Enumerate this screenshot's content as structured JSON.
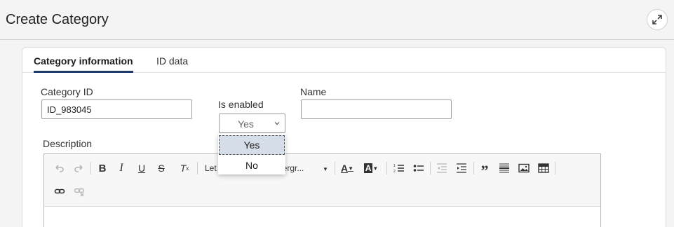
{
  "header": {
    "title": "Create Category",
    "expand_icon": "expand-icon"
  },
  "tabs": [
    {
      "label": "Category information",
      "active": true
    },
    {
      "label": "ID data",
      "active": false
    }
  ],
  "form": {
    "category_id": {
      "label": "Category ID",
      "value": "ID_983045"
    },
    "is_enabled": {
      "label": "Is enabled",
      "value": "Yes",
      "options": [
        "Yes",
        "No"
      ],
      "highlighted": "Yes"
    },
    "name": {
      "label": "Name",
      "value": ""
    },
    "description": {
      "label": "Description"
    }
  },
  "toolbar": {
    "font_combo": "Let",
    "format_combo": "ttergr...",
    "icons": [
      "undo-icon",
      "redo-icon",
      "bold-icon",
      "italic-icon",
      "underline-icon",
      "strikethrough-icon",
      "clear-format-icon",
      "text-color-icon",
      "background-color-icon",
      "numbered-list-icon",
      "bulleted-list-icon",
      "outdent-icon",
      "indent-icon",
      "blockquote-icon",
      "horizontal-rule-icon",
      "image-icon",
      "table-icon",
      "link-icon",
      "unlink-icon"
    ]
  },
  "colors": {
    "accent": "#1f3a6b",
    "highlight": "#d5dde8"
  }
}
